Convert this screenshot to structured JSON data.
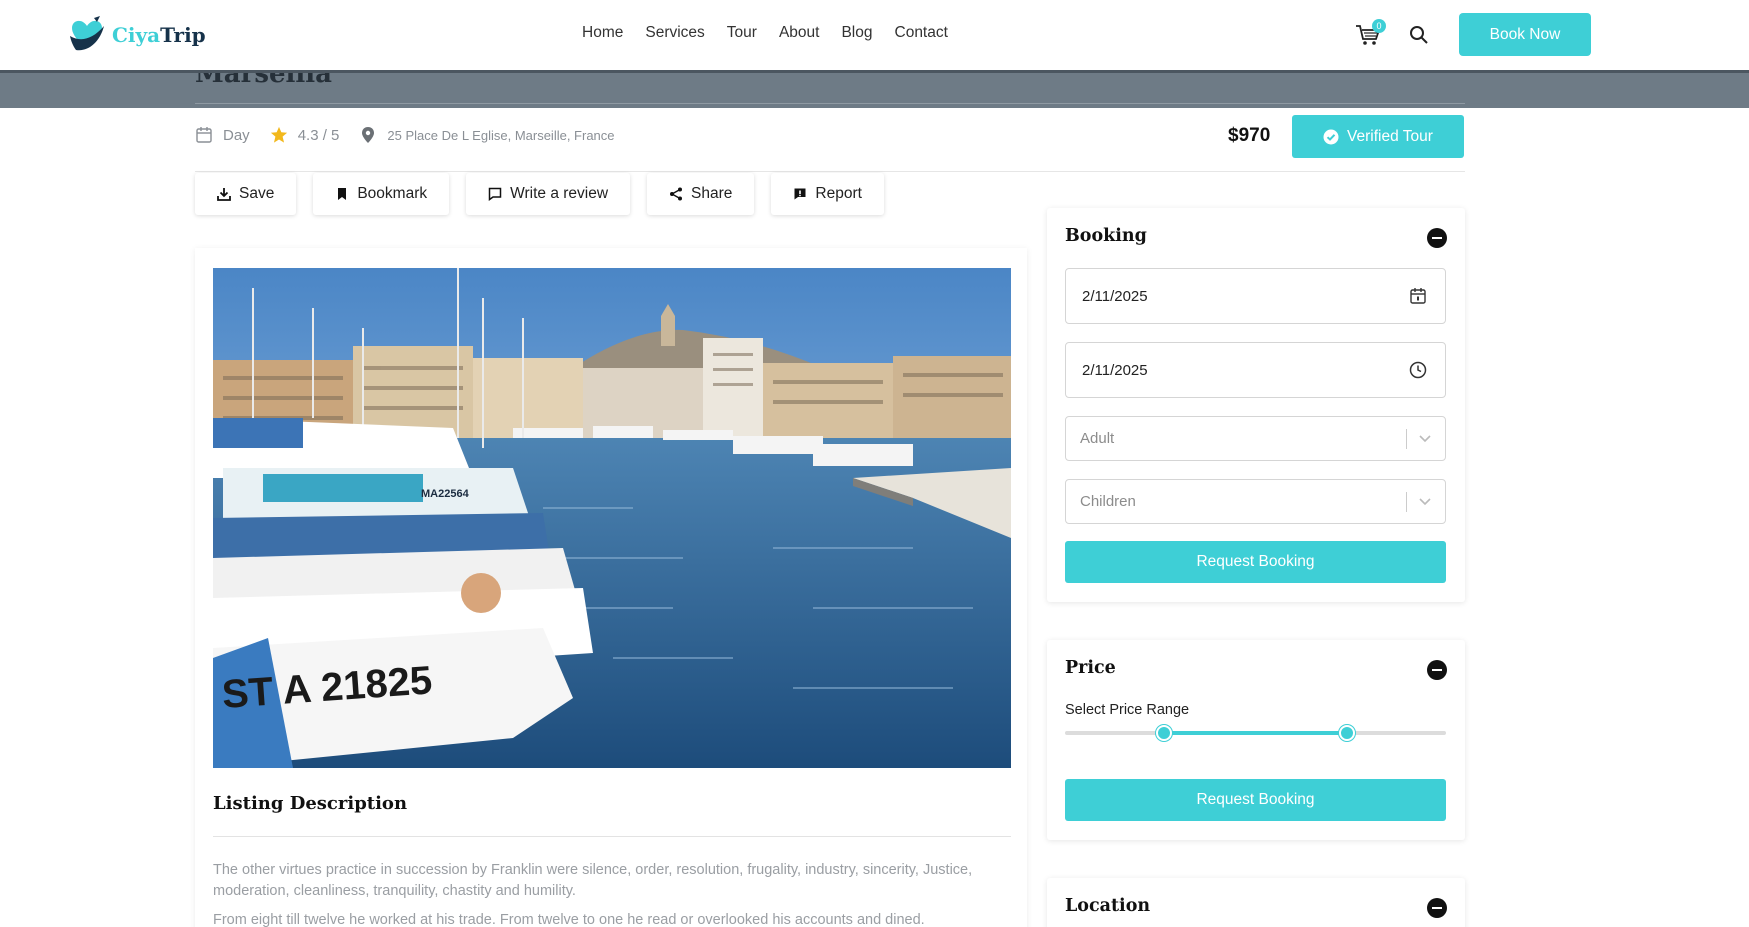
{
  "header": {
    "logo_part1": "Ciya",
    "logo_part2": "Trip",
    "nav": [
      "Home",
      "Services",
      "Tour",
      "About",
      "Blog",
      "Contact"
    ],
    "cart_count": "0",
    "book_now": "Book Now"
  },
  "hero": {
    "title_fragment": "Marseilla"
  },
  "meta": {
    "duration": "Day",
    "rating": "4.3 / 5",
    "address": "25 Place De L Eglise, Marseille, France",
    "price": "$970",
    "verified": "Verified Tour"
  },
  "actions": [
    "Save",
    "Bookmark",
    "Write a review",
    "Share",
    "Report"
  ],
  "listing": {
    "title": "Listing Description",
    "paragraphs": [
      "The other virtues practice in succession by Franklin were silence, order, resolution, frugality, industry, sincerity, Justice, moderation, cleanliness, tranquility, chastity and humility.",
      "From eight till twelve he worked at his trade. From twelve to one he read or overlooked his accounts and dined."
    ],
    "photo_boat_number": "ST A 21825",
    "photo_boat_number2": "MA22564"
  },
  "booking": {
    "title": "Booking",
    "date_value": "2/11/2025",
    "time_value": "2/11/2025",
    "adult_placeholder": "Adult",
    "children_placeholder": "Children",
    "request": "Request Booking"
  },
  "price_card": {
    "title": "Price",
    "range_label": "Select Price Range",
    "range_low": 0.26,
    "range_high": 0.74,
    "request": "Request Booking"
  },
  "location_card": {
    "title": "Location"
  },
  "colors": {
    "accent": "#3ecfd6",
    "navy": "#16324a"
  }
}
